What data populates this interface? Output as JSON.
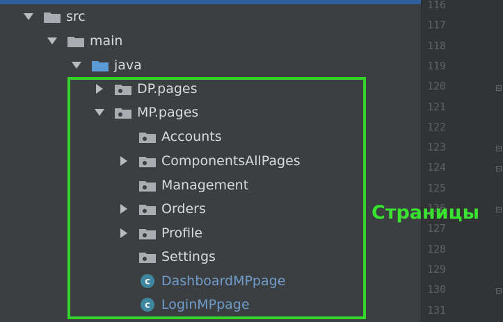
{
  "colors": {
    "background": "#3c3f41",
    "gutter": "#313335",
    "highlight": "#34d42a",
    "label": "#d7dade",
    "class_label": "#6f9ccb"
  },
  "tree": {
    "src": {
      "label": "src",
      "icon": "folder-icon",
      "expanded": true
    },
    "main": {
      "label": "main",
      "icon": "folder-icon",
      "expanded": true
    },
    "java": {
      "label": "java",
      "icon": "source-root-folder-icon",
      "expanded": true
    },
    "dp_pages": {
      "label": "DP.pages",
      "icon": "package-icon",
      "expanded": false
    },
    "mp_pages": {
      "label": "MP.pages",
      "icon": "package-icon",
      "expanded": true
    },
    "accounts": {
      "label": "Accounts",
      "icon": "package-icon"
    },
    "components": {
      "label": "ComponentsAllPages",
      "icon": "package-icon",
      "expanded": false
    },
    "management": {
      "label": "Management",
      "icon": "package-icon"
    },
    "orders": {
      "label": "Orders",
      "icon": "package-icon",
      "expanded": false
    },
    "profile": {
      "label": "Profile",
      "icon": "package-icon",
      "expanded": false
    },
    "settings": {
      "label": "Settings",
      "icon": "package-icon"
    },
    "dashboard": {
      "label": "DashboardMPpage",
      "icon": "class-icon"
    },
    "login": {
      "label": "LoginMPpage",
      "icon": "class-icon"
    }
  },
  "editor": {
    "line_numbers": [
      "116",
      "117",
      "118",
      "119",
      "120",
      "121",
      "122",
      "123",
      "124",
      "125",
      "126",
      "127",
      "128",
      "129",
      "130",
      "131"
    ]
  },
  "annotation": {
    "text": "Страницы"
  }
}
